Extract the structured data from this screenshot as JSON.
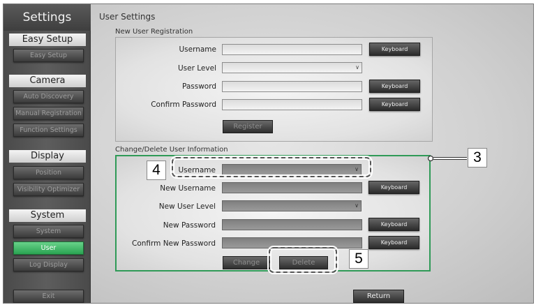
{
  "sidebar": {
    "title": "Settings",
    "sections": {
      "easy_setup": {
        "header": "Easy Setup",
        "items": [
          "Easy Setup"
        ]
      },
      "camera": {
        "header": "Camera",
        "items": [
          "Auto Discovery",
          "Manual Registration",
          "Function Settings"
        ]
      },
      "display": {
        "header": "Display",
        "items": [
          "Position",
          "Visibility Optimizer"
        ]
      },
      "system": {
        "header": "System",
        "items": [
          "System",
          "User",
          "Log Display"
        ]
      }
    },
    "active_item": "User",
    "exit_label": "Exit"
  },
  "main": {
    "title": "User Settings",
    "registration": {
      "heading": "New User Registration",
      "username_label": "Username",
      "user_level_label": "User Level",
      "password_label": "Password",
      "confirm_password_label": "Confirm Password",
      "keyboard_label": "Keyboard",
      "register_label": "Register"
    },
    "change_delete": {
      "heading": "Change/Delete User Information",
      "username_label": "Username",
      "new_username_label": "New Username",
      "new_user_level_label": "New User Level",
      "new_password_label": "New Password",
      "confirm_new_password_label": "Confirm New Password",
      "keyboard_label": "Keyboard",
      "change_label": "Change",
      "delete_label": "Delete"
    },
    "return_label": "Return"
  },
  "callouts": {
    "three": "3",
    "four": "4",
    "five": "5"
  },
  "colors": {
    "active_green": "#2aa351",
    "panel_border_green": "#2f9a57"
  },
  "icons": {
    "dropdown": "chevron-down-icon"
  }
}
